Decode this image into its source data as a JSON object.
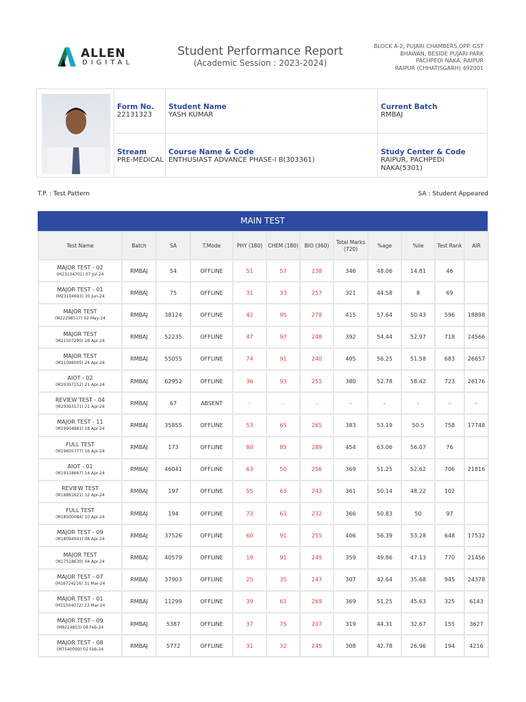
{
  "header": {
    "brand": "ALLEN",
    "brand_sub": "DIGITAL",
    "title": "Student Performance Report",
    "session": "(Academic Session : 2023-2024)",
    "address": [
      "BLOCK A-2, PUJARI CHAMBERS,OPP. GST",
      "BHAWAN, BESIDE PUJARI PARK",
      "PACHPEDI NAKA, RAIPUR",
      "RAIPUR (CHHATISGARH) 492001"
    ]
  },
  "student": {
    "form_no_label": "Form No.",
    "form_no": "22131323",
    "name_label": "Student Name",
    "name": "YASH KUMAR",
    "batch_label": "Current Batch",
    "batch": "RMBAJ",
    "stream_label": "Stream",
    "stream": "PRE-MEDICAL",
    "course_label": "Course Name & Code",
    "course": "ENTHUSIAST ADVANCE PHASE-I B(303361)",
    "center_label": "Study Center & Code",
    "center": "RAIPUR, PACHPEDI NAKA(5301)"
  },
  "legend": {
    "tp": "T.P. : Test Pattern",
    "sa": "SA : Student Appeared"
  },
  "colors": {
    "accent": "#2b4aa0",
    "score": "#e53935"
  },
  "main_test": {
    "title": "MAIN TEST",
    "columns": [
      "Test Name",
      "Batch",
      "SA",
      "T.Mode",
      "PHY (180)",
      "CHEM (180)",
      "BIO (360)",
      "Total Marks (720)",
      "%age",
      "%ile",
      "Test Rank",
      "AIR"
    ],
    "rows": [
      [
        "MAJOR TEST - 02",
        "(M23104701) 07 Jul-24",
        "RMBAJ",
        "54",
        "OFFLINE",
        "51",
        "57",
        "238",
        "346",
        "48.06",
        "14.81",
        "46",
        ""
      ],
      [
        "MAJOR TEST - 01",
        "(M23104693) 30 Jun-24",
        "RMBAJ",
        "75",
        "OFFLINE",
        "31",
        "33",
        "257",
        "321",
        "44.58",
        "8",
        "69",
        ""
      ],
      [
        "MAJOR TEST",
        "(M22298517) 02 May-24",
        "RMBAJ",
        "38124",
        "OFFLINE",
        "42",
        "95",
        "278",
        "415",
        "57.64",
        "50.43",
        "596",
        "18898"
      ],
      [
        "MAJOR TEST",
        "(M21507290) 28 Apr-24",
        "RMBAJ",
        "52235",
        "OFFLINE",
        "47",
        "97",
        "248",
        "392",
        "54.44",
        "52.97",
        "718",
        "24566"
      ],
      [
        "MAJOR TEST",
        "(M21098005) 24 Apr-24",
        "RMBAJ",
        "55055",
        "OFFLINE",
        "74",
        "91",
        "240",
        "405",
        "56.25",
        "51.58",
        "683",
        "26657"
      ],
      [
        "AIOT - 02",
        "(M20397152) 21 Apr-24",
        "RMBAJ",
        "62952",
        "OFFLINE",
        "36",
        "93",
        "251",
        "380",
        "52.78",
        "58.42",
        "723",
        "26176"
      ],
      [
        "REVIEW TEST - 04",
        "(M20393171) 21 Apr-24",
        "RMBAJ",
        "67",
        "ABSENT",
        "-",
        "-",
        "-",
        "-",
        "-",
        "-",
        "-",
        "-"
      ],
      [
        "MAJOR TEST - 11",
        "(M19904881) 18 Apr-24",
        "RMBAJ",
        "35855",
        "OFFLINE",
        "53",
        "65",
        "265",
        "383",
        "53.19",
        "50.5",
        "758",
        "17748"
      ],
      [
        "FULL TEST",
        "(M19605777) 16 Apr-24",
        "RMBAJ",
        "173",
        "OFFLINE",
        "80",
        "85",
        "289",
        "454",
        "63.06",
        "56.07",
        "76",
        ""
      ],
      [
        "AIOT - 01",
        "(M19118667) 14 Apr-24",
        "RMBAJ",
        "46041",
        "OFFLINE",
        "63",
        "50",
        "256",
        "369",
        "51.25",
        "52.62",
        "706",
        "21816"
      ],
      [
        "REVIEW TEST",
        "(M18881621) 12 Apr-24",
        "RMBAJ",
        "197",
        "OFFLINE",
        "55",
        "63",
        "243",
        "361",
        "50.14",
        "48.22",
        "102",
        ""
      ],
      [
        "FULL TEST",
        "(M18500084) 10 Apr-24",
        "RMBAJ",
        "194",
        "OFFLINE",
        "73",
        "61",
        "232",
        "366",
        "50.83",
        "50",
        "97",
        ""
      ],
      [
        "MAJOR TEST - 09",
        "(M18094941) 08 Apr-24",
        "RMBAJ",
        "37526",
        "OFFLINE",
        "60",
        "91",
        "255",
        "406",
        "56.39",
        "53.28",
        "648",
        "17532"
      ],
      [
        "MAJOR TEST",
        "(M17518630) 04 Apr-24",
        "RMBAJ",
        "40579",
        "OFFLINE",
        "19",
        "91",
        "249",
        "359",
        "49.86",
        "47.13",
        "770",
        "21456"
      ],
      [
        "MAJOR TEST - 07",
        "(M16724216) 31 Mar-24",
        "RMBAJ",
        "37903",
        "OFFLINE",
        "25",
        "35",
        "247",
        "307",
        "42.64",
        "35.68",
        "945",
        "24378"
      ],
      [
        "MAJOR TEST - 01",
        "(M15504072) 23 Mar-24",
        "RMBAJ",
        "11299",
        "OFFLINE",
        "39",
        "61",
        "269",
        "369",
        "51.25",
        "45.63",
        "325",
        "6143"
      ],
      [
        "MAJOR TEST - 09",
        "(M8224853) 08 Feb-24",
        "RMBAJ",
        "5387",
        "OFFLINE",
        "37",
        "75",
        "207",
        "319",
        "44.31",
        "32.67",
        "155",
        "3627"
      ],
      [
        "MAJOR TEST - 08",
        "(M7540099) 02 Feb-24",
        "RMBAJ",
        "5772",
        "OFFLINE",
        "31",
        "32",
        "245",
        "308",
        "42.78",
        "26.96",
        "194",
        "4216"
      ]
    ]
  }
}
